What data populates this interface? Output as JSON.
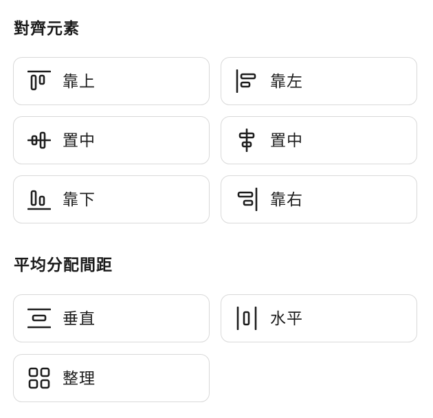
{
  "align_section": {
    "title": "對齊元素",
    "buttons": [
      {
        "label": "靠上",
        "icon": "align-top-icon"
      },
      {
        "label": "靠左",
        "icon": "align-left-icon"
      },
      {
        "label": "置中",
        "icon": "align-center-vertical-icon"
      },
      {
        "label": "置中",
        "icon": "align-center-horizontal-icon"
      },
      {
        "label": "靠下",
        "icon": "align-bottom-icon"
      },
      {
        "label": "靠右",
        "icon": "align-right-icon"
      }
    ]
  },
  "distribute_section": {
    "title": "平均分配間距",
    "buttons": [
      {
        "label": "垂直",
        "icon": "distribute-vertical-icon"
      },
      {
        "label": "水平",
        "icon": "distribute-horizontal-icon"
      },
      {
        "label": "整理",
        "icon": "tidy-grid-icon"
      }
    ]
  }
}
